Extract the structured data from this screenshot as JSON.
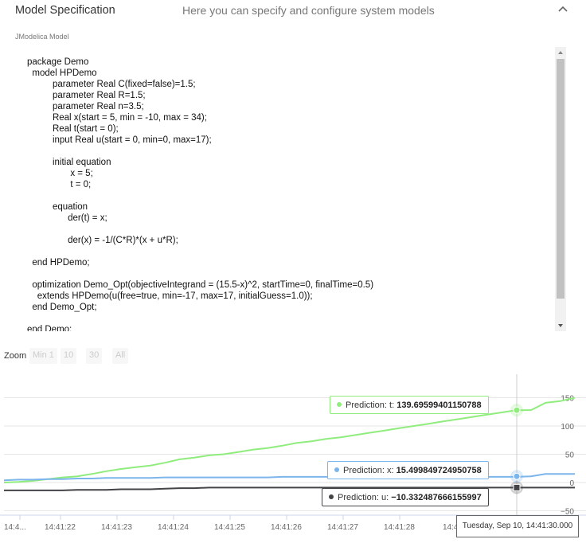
{
  "header": {
    "title": "Model Specification",
    "subtitle": "Here you can specify and configure system models"
  },
  "model": {
    "label": "JModelica Model",
    "code": "package Demo\n  model HPDemo\n          parameter Real C(fixed=false)=1.5;\n          parameter Real R=1.5;\n          parameter Real n=3.5;\n          Real x(start = 5, min = -10, max = 34);\n          Real t(start = 0);\n          input Real u(start = 0, min=0, max=17);\n\n          initial equation\n                 x = 5;\n                 t = 0;\n\n          equation\n                der(t) = x;\n\n                der(x) = -1/(C*R)*(x + u*R);\n\n  end HPDemo;\n\n  optimization Demo_Opt(objectiveIntegrand = (15.5-x)^2, startTime=0, finalTime=0.5)\n    extends HPDemo(u(free=true, min=-17, max=17, initialGuess=1.0));\n  end Demo_Opt;\n\nend Demo;"
  },
  "zoom": {
    "label": "Zoom",
    "buttons": [
      "Min 1",
      "10",
      "30",
      "All"
    ]
  },
  "colors": {
    "t_series": "#90ed7d",
    "x_series": "#7cb5ec",
    "u_series": "#434348"
  },
  "chart_data": {
    "type": "line",
    "x": [
      "14:41:21.0",
      "14:41:21.25",
      "14:41:21.5",
      "14:41:21.75",
      "14:41:22.0",
      "14:41:22.25",
      "14:41:22.5",
      "14:41:22.75",
      "14:41:23.0",
      "14:41:23.25",
      "14:41:23.5",
      "14:41:23.75",
      "14:41:24.0",
      "14:41:24.25",
      "14:41:24.5",
      "14:41:24.75",
      "14:41:25.0",
      "14:41:25.25",
      "14:41:25.5",
      "14:41:25.75",
      "14:41:26.0",
      "14:41:26.25",
      "14:41:26.5",
      "14:41:26.75",
      "14:41:27.0",
      "14:41:27.25",
      "14:41:27.5",
      "14:41:27.75",
      "14:41:28.0",
      "14:41:28.25",
      "14:41:28.5",
      "14:41:28.75",
      "14:41:29.0",
      "14:41:29.25",
      "14:41:29.5",
      "14:41:29.75",
      "14:41:30.0",
      "14:41:30.25",
      "14:41:30.5",
      "14:41:30.75"
    ],
    "x_tick_labels": [
      "14:4...",
      "14:41:22",
      "14:41:23",
      "14:41:24",
      "14:41:25",
      "14:41:26",
      "14:41:27",
      "14:41:28",
      "14:4",
      "14:41:30"
    ],
    "series": [
      {
        "name": "Prediction: t",
        "values": [
          0,
          1,
          3,
          6,
          9,
          11,
          15,
          20,
          24,
          27,
          30,
          35,
          41,
          44,
          48,
          50,
          54,
          58,
          61,
          65,
          70,
          73,
          77,
          80,
          84,
          88,
          92,
          96,
          100,
          104,
          108,
          112,
          116,
          120,
          124,
          128,
          139.69599401150788,
          141,
          144,
          150
        ]
      },
      {
        "name": "Prediction: x",
        "values": [
          4,
          5,
          5,
          6,
          6,
          7,
          7,
          8,
          8,
          8,
          8,
          9,
          9,
          9,
          9,
          9,
          9,
          9,
          9,
          10,
          10,
          10,
          10,
          10,
          10,
          10,
          10,
          10,
          10,
          10,
          10,
          10,
          10,
          10,
          10,
          10,
          15.499849724950758,
          15,
          15,
          15
        ]
      },
      {
        "name": "Prediction: u",
        "values": [
          -14,
          -14,
          -14,
          -14,
          -14,
          -13,
          -13,
          -13,
          -12,
          -12,
          -12,
          -11,
          -10,
          -10,
          -9,
          -9,
          -9,
          -9,
          -9,
          -9,
          -9,
          -9,
          -9,
          -9,
          -9,
          -9,
          -9,
          -9,
          -9,
          -9,
          -9,
          -9,
          -9,
          -9,
          -9,
          -9,
          -10.332487666155997,
          -9,
          -9,
          -9
        ]
      }
    ],
    "highlight_index": 36,
    "y_ticks": [
      150,
      100,
      50,
      0,
      -50
    ],
    "ylim": [
      -50,
      150
    ],
    "tooltips": {
      "t": {
        "label": "Prediction: t:",
        "value": "139.69599401150788"
      },
      "x": {
        "label": "Prediction: x:",
        "value": "15.499849724950758"
      },
      "u": {
        "label": "Prediction: u:",
        "value": "−10.332487666155997"
      },
      "date": "Tuesday, Sep 10, 14:41:30.000"
    }
  }
}
